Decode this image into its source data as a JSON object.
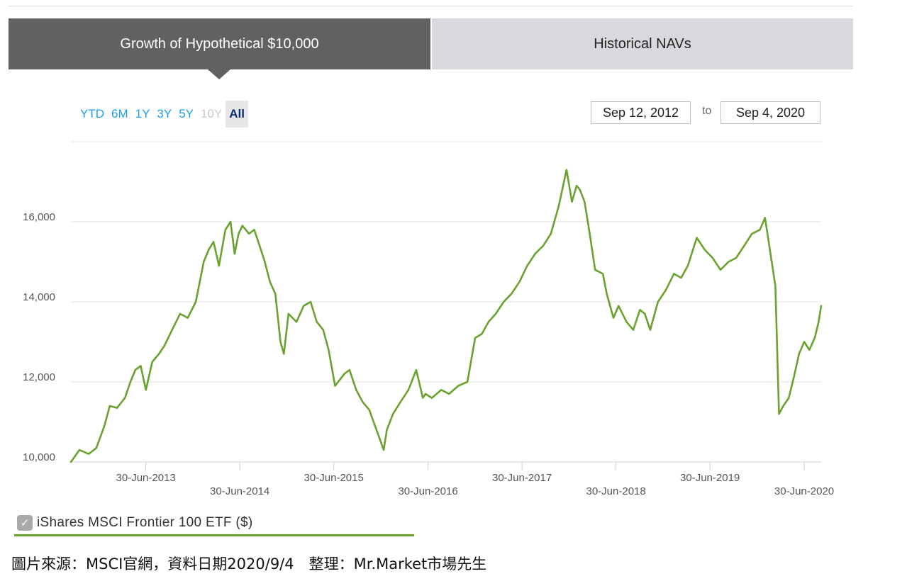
{
  "tabs": [
    {
      "label": "Growth of Hypothetical $10,000"
    },
    {
      "label": "Historical NAVs"
    }
  ],
  "ranges": [
    "YTD",
    "6M",
    "1Y",
    "3Y",
    "5Y",
    "10Y",
    "All"
  ],
  "range_state": {
    "selected": "All",
    "disabled": [
      "10Y"
    ]
  },
  "date_range": {
    "from": "Sep 12, 2012",
    "separator": "to",
    "to": "Sep 4, 2020"
  },
  "legend": {
    "label": "iShares MSCI Frontier 100 ETF ($)",
    "checked": true,
    "check_glyph": "✓"
  },
  "caption": "圖片來源：MSCI官網，資料日期2020/9/4　整理：Mr.Market市場先生",
  "colors": {
    "line": "#6aa230",
    "tab_active": "#616161",
    "tab_inactive": "#d9d9dd",
    "range_link": "#1ea0e6"
  },
  "chart_data": {
    "type": "line",
    "title": "",
    "xlabel": "",
    "ylabel": "",
    "ylim": [
      10000,
      18000
    ],
    "yticks": [
      10000,
      12000,
      14000,
      16000
    ],
    "ytick_labels": [
      "10,000",
      "12,000",
      "14,000",
      "16,000"
    ],
    "xlim": [
      "2012-09-12",
      "2020-09-04"
    ],
    "xticks": [
      "2013-06-30",
      "2014-06-30",
      "2015-06-30",
      "2016-06-30",
      "2017-06-30",
      "2018-06-30",
      "2019-06-30",
      "2020-06-30"
    ],
    "xtick_labels": [
      "30-Jun-2013",
      "30-Jun-2014",
      "30-Jun-2015",
      "30-Jun-2016",
      "30-Jun-2017",
      "30-Jun-2018",
      "30-Jun-2019",
      "30-Jun-2020"
    ],
    "grid": true,
    "series": [
      {
        "name": "iShares MSCI Frontier 100 ETF ($)",
        "x": [
          "2012-09-12",
          "2012-10-15",
          "2012-11-20",
          "2012-12-20",
          "2013-01-20",
          "2013-02-10",
          "2013-03-10",
          "2013-04-10",
          "2013-05-01",
          "2013-05-20",
          "2013-06-10",
          "2013-06-30",
          "2013-07-25",
          "2013-08-20",
          "2013-09-10",
          "2013-10-10",
          "2013-11-10",
          "2013-12-10",
          "2014-01-10",
          "2014-02-10",
          "2014-03-01",
          "2014-03-20",
          "2014-04-10",
          "2014-05-05",
          "2014-05-25",
          "2014-06-10",
          "2014-06-25",
          "2014-07-10",
          "2014-08-05",
          "2014-08-25",
          "2014-09-15",
          "2014-10-05",
          "2014-10-25",
          "2014-11-15",
          "2014-12-05",
          "2014-12-18",
          "2015-01-05",
          "2015-02-05",
          "2015-03-05",
          "2015-04-01",
          "2015-04-25",
          "2015-05-20",
          "2015-06-10",
          "2015-07-05",
          "2015-08-10",
          "2015-08-30",
          "2015-09-25",
          "2015-10-20",
          "2015-11-15",
          "2016-01-10",
          "2016-01-22",
          "2016-02-15",
          "2016-03-15",
          "2016-04-15",
          "2016-05-15",
          "2016-06-10",
          "2016-06-20",
          "2016-07-15",
          "2016-08-20",
          "2016-09-20",
          "2016-10-25",
          "2016-11-30",
          "2016-12-30",
          "2017-01-25",
          "2017-02-20",
          "2017-03-20",
          "2017-04-20",
          "2017-05-20",
          "2017-06-20",
          "2017-07-20",
          "2017-08-20",
          "2017-09-20",
          "2017-10-20",
          "2017-11-20",
          "2017-12-20",
          "2018-01-10",
          "2018-01-28",
          "2018-02-10",
          "2018-02-28",
          "2018-03-20",
          "2018-04-10",
          "2018-05-10",
          "2018-05-25",
          "2018-06-20",
          "2018-07-10",
          "2018-08-10",
          "2018-09-05",
          "2018-10-01",
          "2018-10-20",
          "2018-11-10",
          "2018-12-10",
          "2019-01-10",
          "2019-02-10",
          "2019-03-10",
          "2019-04-05",
          "2019-05-10",
          "2019-06-10",
          "2019-07-10",
          "2019-08-10",
          "2019-09-10",
          "2019-10-10",
          "2019-11-10",
          "2019-12-10",
          "2020-01-10",
          "2020-01-30",
          "2020-02-20",
          "2020-03-10",
          "2020-03-24",
          "2020-04-10",
          "2020-05-01",
          "2020-05-20",
          "2020-06-10",
          "2020-06-30",
          "2020-07-20",
          "2020-08-10",
          "2020-08-25",
          "2020-09-04"
        ],
        "values": [
          10000,
          10300,
          10200,
          10350,
          10900,
          11400,
          11350,
          11600,
          12000,
          12300,
          12400,
          11800,
          12500,
          12700,
          12900,
          13300,
          13700,
          13600,
          14000,
          15000,
          15300,
          15500,
          14900,
          15800,
          16000,
          15200,
          15700,
          15900,
          15700,
          15800,
          15400,
          15000,
          14500,
          14200,
          13000,
          12700,
          13700,
          13500,
          13900,
          14000,
          13500,
          13300,
          12800,
          11900,
          12200,
          12300,
          11800,
          11500,
          11300,
          10300,
          10800,
          11200,
          11500,
          11800,
          12300,
          11600,
          11700,
          11600,
          11800,
          11700,
          11900,
          12000,
          13100,
          13200,
          13500,
          13700,
          14000,
          14200,
          14500,
          14900,
          15200,
          15400,
          15700,
          16400,
          17300,
          16500,
          16900,
          16800,
          16500,
          15700,
          14800,
          14700,
          14200,
          13600,
          13900,
          13500,
          13300,
          13800,
          13700,
          13300,
          14000,
          14300,
          14700,
          14600,
          14900,
          15600,
          15300,
          15100,
          14800,
          15000,
          15100,
          15400,
          15700,
          15800,
          16100,
          15200,
          14400,
          11200,
          11400,
          11600,
          12100,
          12700,
          13000,
          12800,
          13100,
          13500,
          13900
        ]
      }
    ]
  }
}
